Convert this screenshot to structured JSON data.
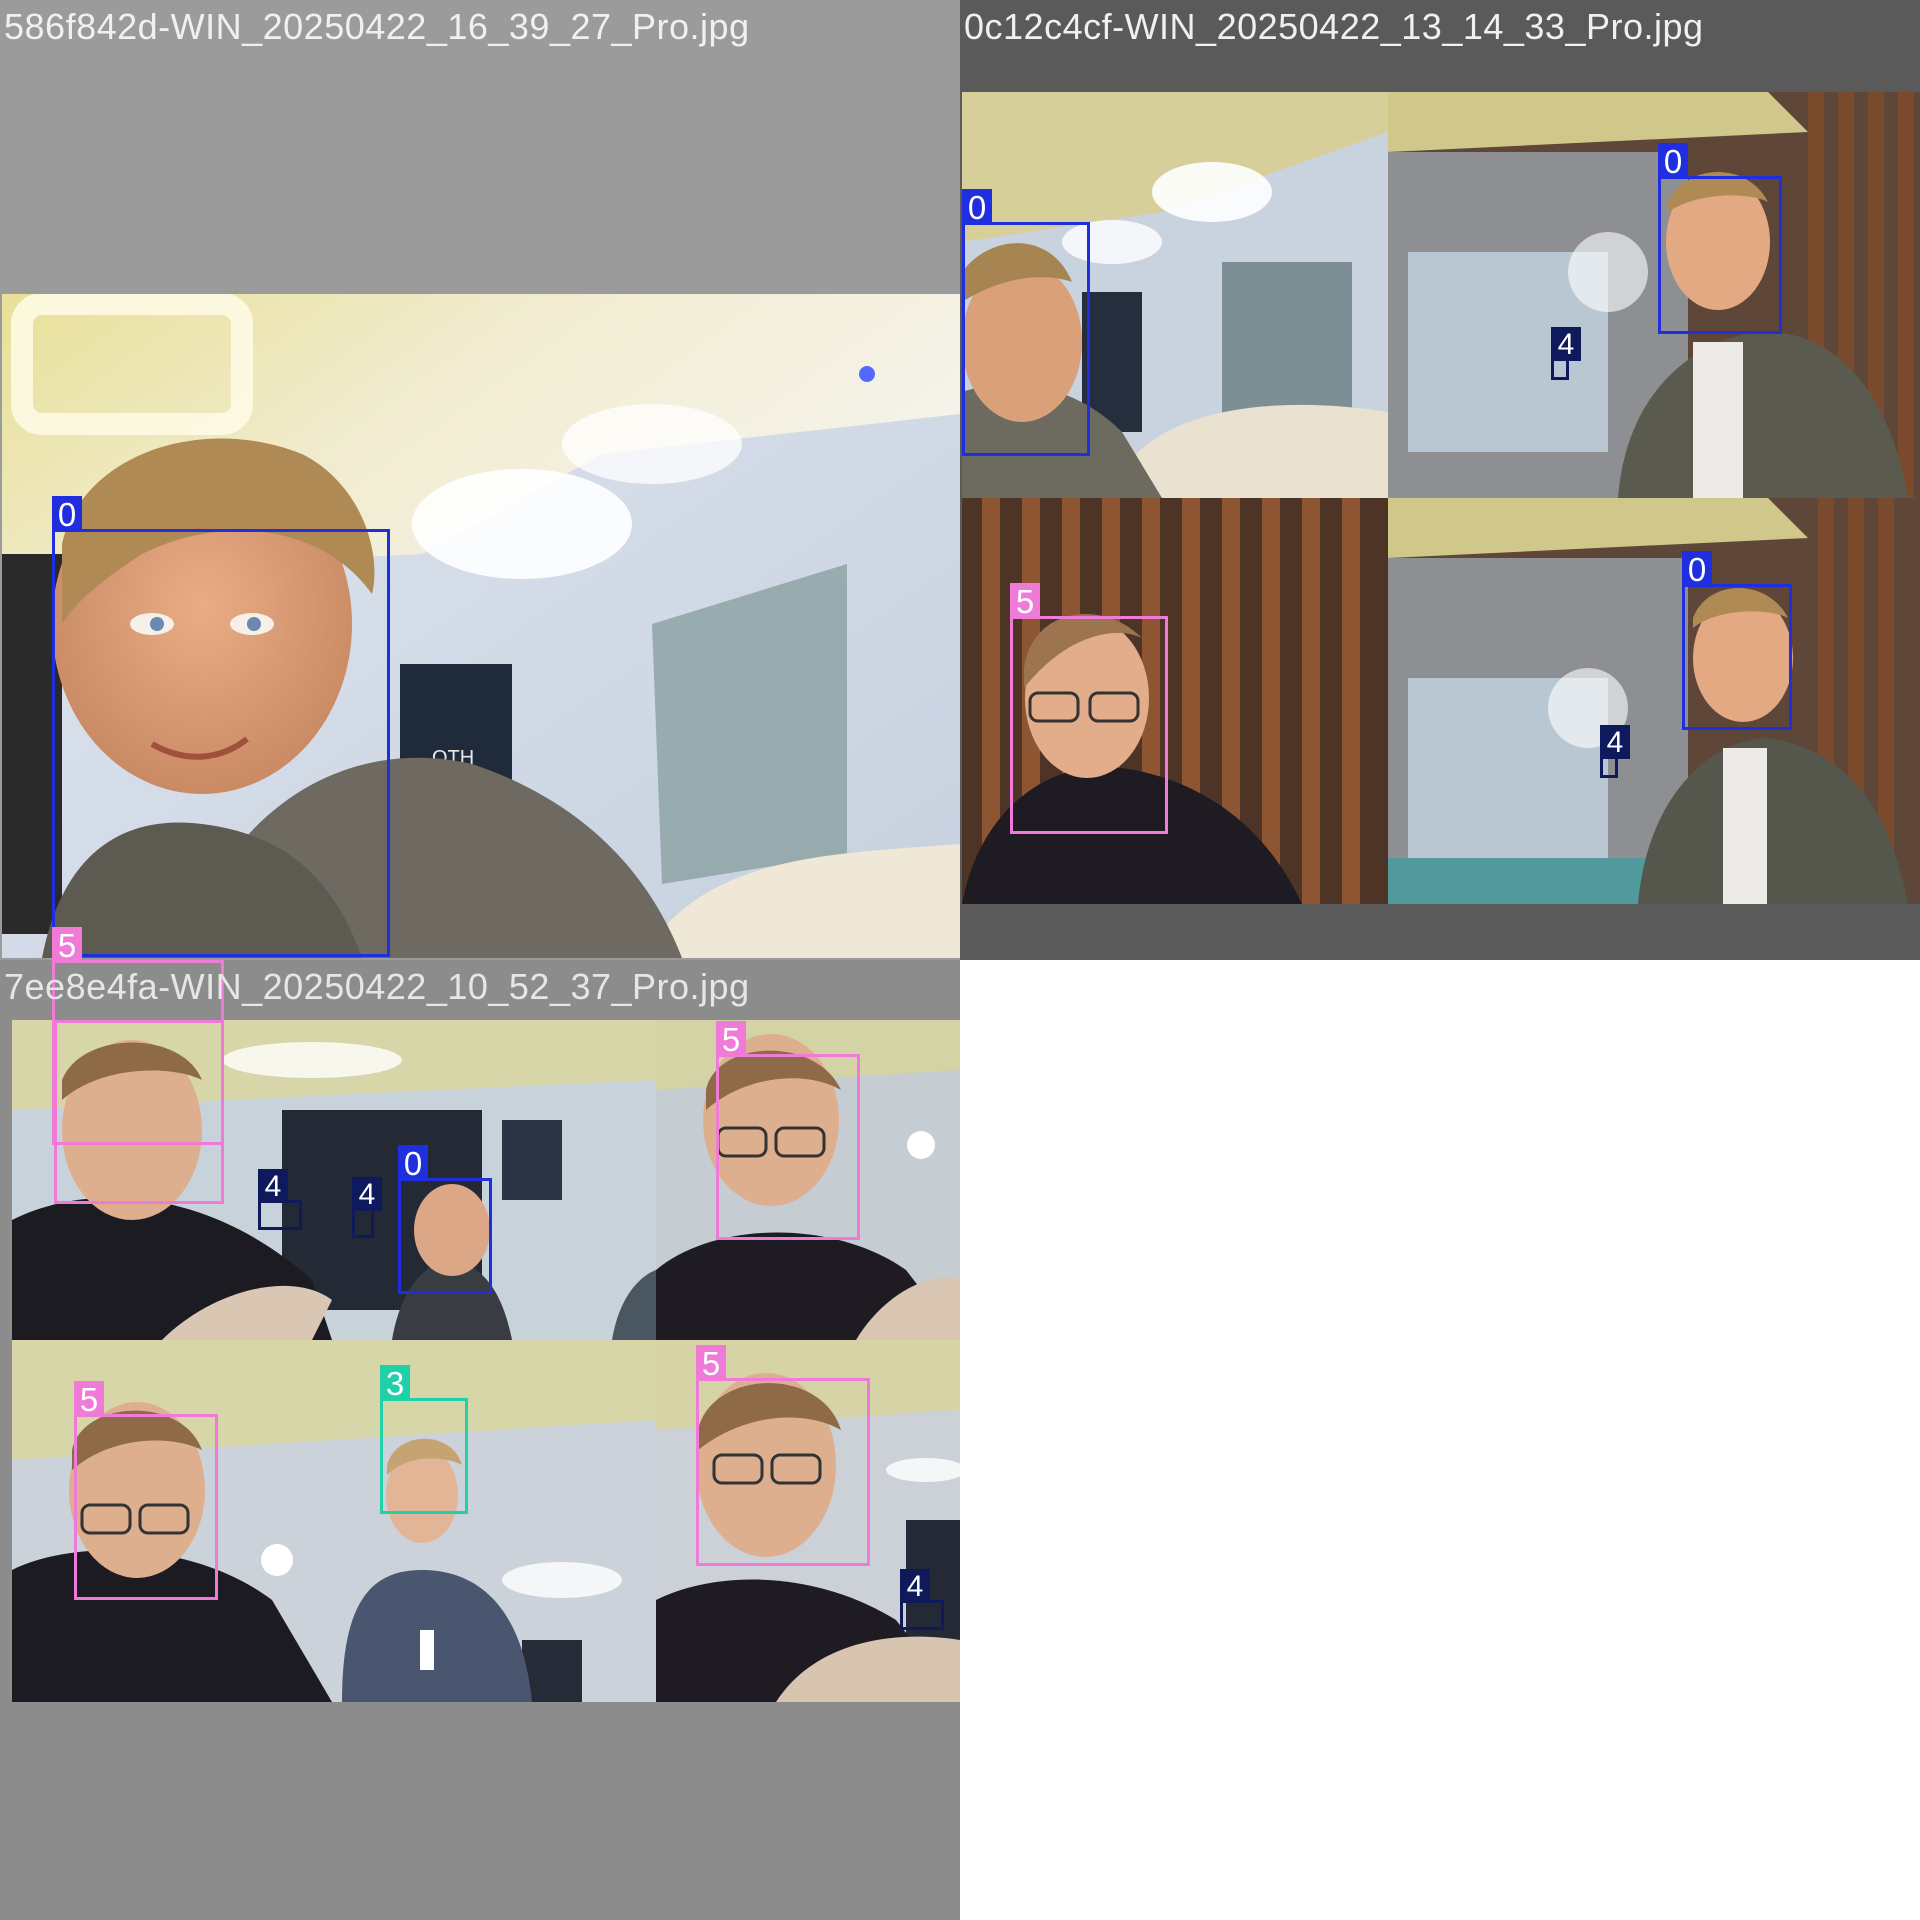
{
  "tiles": [
    {
      "filename": "586f842d-WIN_20250422_16_39_27_Pro.jpg"
    },
    {
      "filename": "0c12c4cf-WIN_20250422_13_14_33_Pro.jpg"
    },
    {
      "filename": "7ee8e4fa-WIN_20250422_10_52_37_Pro.jpg"
    }
  ],
  "detections": [
    {
      "tile": 0,
      "class_label": "0"
    },
    {
      "tile": 0,
      "class_label": "5"
    },
    {
      "tile": 1,
      "class_label": "0"
    },
    {
      "tile": 1,
      "class_label": "0"
    },
    {
      "tile": 1,
      "class_label": "4"
    },
    {
      "tile": 1,
      "class_label": "5"
    },
    {
      "tile": 1,
      "class_label": "0"
    },
    {
      "tile": 1,
      "class_label": "4"
    },
    {
      "tile": 2,
      "class_label": "5"
    },
    {
      "tile": 2,
      "class_label": "4"
    },
    {
      "tile": 2,
      "class_label": "4"
    },
    {
      "tile": 2,
      "class_label": "0"
    },
    {
      "tile": 2,
      "class_label": "5"
    },
    {
      "tile": 2,
      "class_label": "5"
    },
    {
      "tile": 2,
      "class_label": "3"
    },
    {
      "tile": 2,
      "class_label": "5"
    },
    {
      "tile": 2,
      "class_label": "4"
    }
  ],
  "colors": {
    "class_0": "#1f2fe0",
    "class_3": "#1fd0a8",
    "class_4": "#0e1a5c",
    "class_5": "#f07ad8",
    "letterbox_gray": "#8c8c8c",
    "letterbox_dark": "#5a5a5a"
  }
}
